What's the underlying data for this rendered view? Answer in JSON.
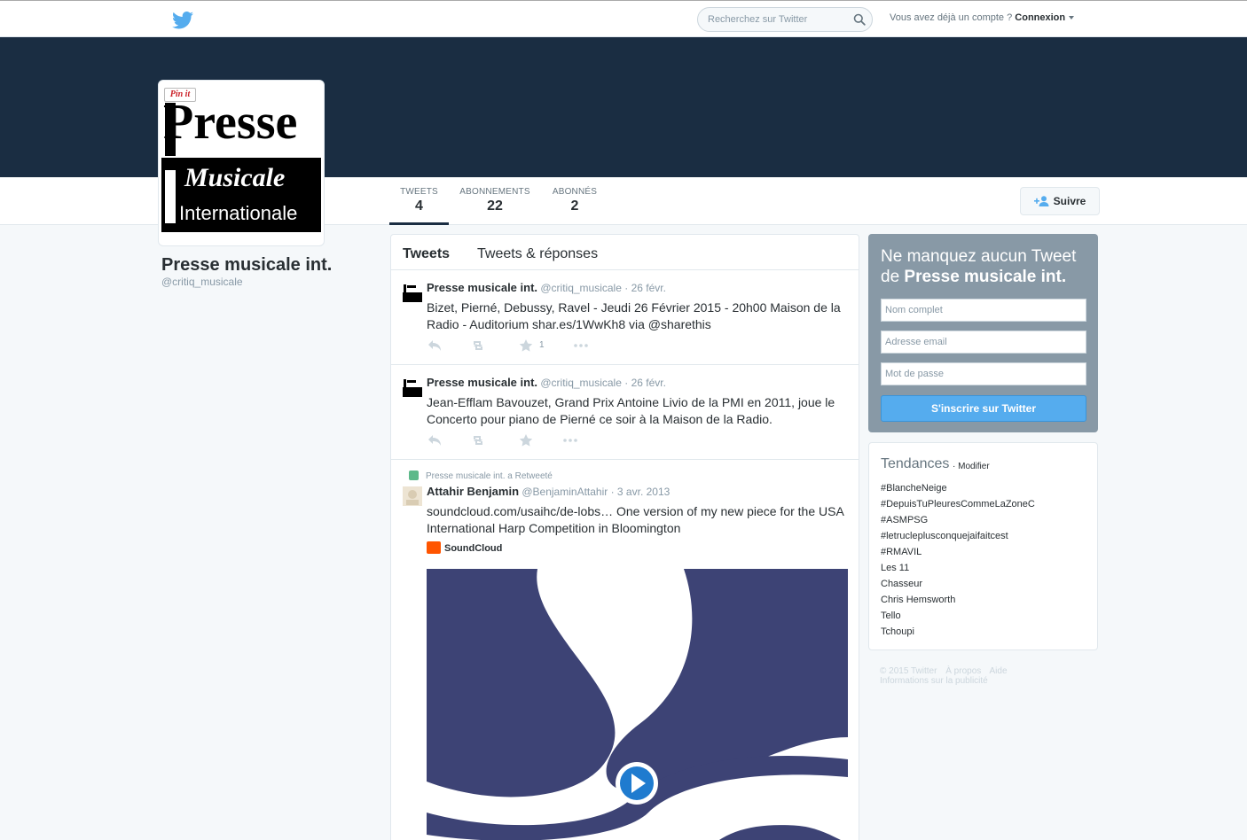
{
  "topbar": {
    "search_placeholder": "Recherchez sur Twitter",
    "login_prompt": "Vous avez déjà un compte ?",
    "login_link": "Connexion"
  },
  "colors": {
    "banner": "#1a2d42",
    "accent": "#55acee",
    "signup_panel": "#8899a6"
  },
  "avatar": {
    "pin_label": "Pin it",
    "logo_lines": [
      "Presse",
      "Musicale",
      "Internationale"
    ]
  },
  "profile": {
    "name": "Presse musicale int.",
    "handle": "@critiq_musicale",
    "follow_label": "Suivre",
    "stats": [
      {
        "label": "TWEETS",
        "value": "4"
      },
      {
        "label": "ABONNEMENTS",
        "value": "22"
      },
      {
        "label": "ABONNÉS",
        "value": "2"
      }
    ]
  },
  "timeline": {
    "tabs": [
      "Tweets",
      "Tweets & réponses"
    ],
    "tweets": [
      {
        "name": "Presse musicale int.",
        "handle": "@critiq_musicale",
        "date": "· 26 févr.",
        "text": "Bizet, Pierné, Debussy, Ravel - Jeudi 26 Février 2015 - 20h00 Maison de la Radio - Auditorium shar.es/1WwKh8 via @sharethis",
        "favorites": "1"
      },
      {
        "name": "Presse musicale int.",
        "handle": "@critiq_musicale",
        "date": "· 26 févr.",
        "text": "Jean-Efflam Bavouzet, Grand Prix Antoine Livio de la PMI en 2011, joue le Concerto pour piano de Pierné ce soir à la Maison de la Radio."
      },
      {
        "retweet_label": "Presse musicale int. a Retweeté",
        "name": "Attahir Benjamin",
        "handle": "@BenjaminAttahir",
        "date": "· 3 avr. 2013",
        "text": "soundcloud.com/usaihc/de-lobs… One version of my new piece for the USA International Harp Competition in Bloomington",
        "card_source": "SoundCloud"
      }
    ]
  },
  "signup": {
    "title_prefix": "Ne manquez aucun Tweet de",
    "title_name": "Presse musicale int.",
    "name_placeholder": "Nom complet",
    "email_placeholder": "Adresse email",
    "password_placeholder": "Mot de passe",
    "button": "S'inscrire sur Twitter"
  },
  "trends": {
    "title": "Tendances",
    "modify": "· Modifier",
    "items": [
      "#BlancheNeige",
      "#DepuisTuPleuresCommeLaZoneC",
      "#ASMPSG",
      "#letrucleplusconquejaifaitcest",
      "#RMAVIL",
      "Les 11",
      "Chasseur",
      "Chris Hemsworth",
      "Tello",
      "Tchoupi"
    ]
  },
  "footer": {
    "copyright": "© 2015 Twitter",
    "about": "À propos",
    "help": "Aide",
    "ads": "Informations sur la publicité"
  }
}
